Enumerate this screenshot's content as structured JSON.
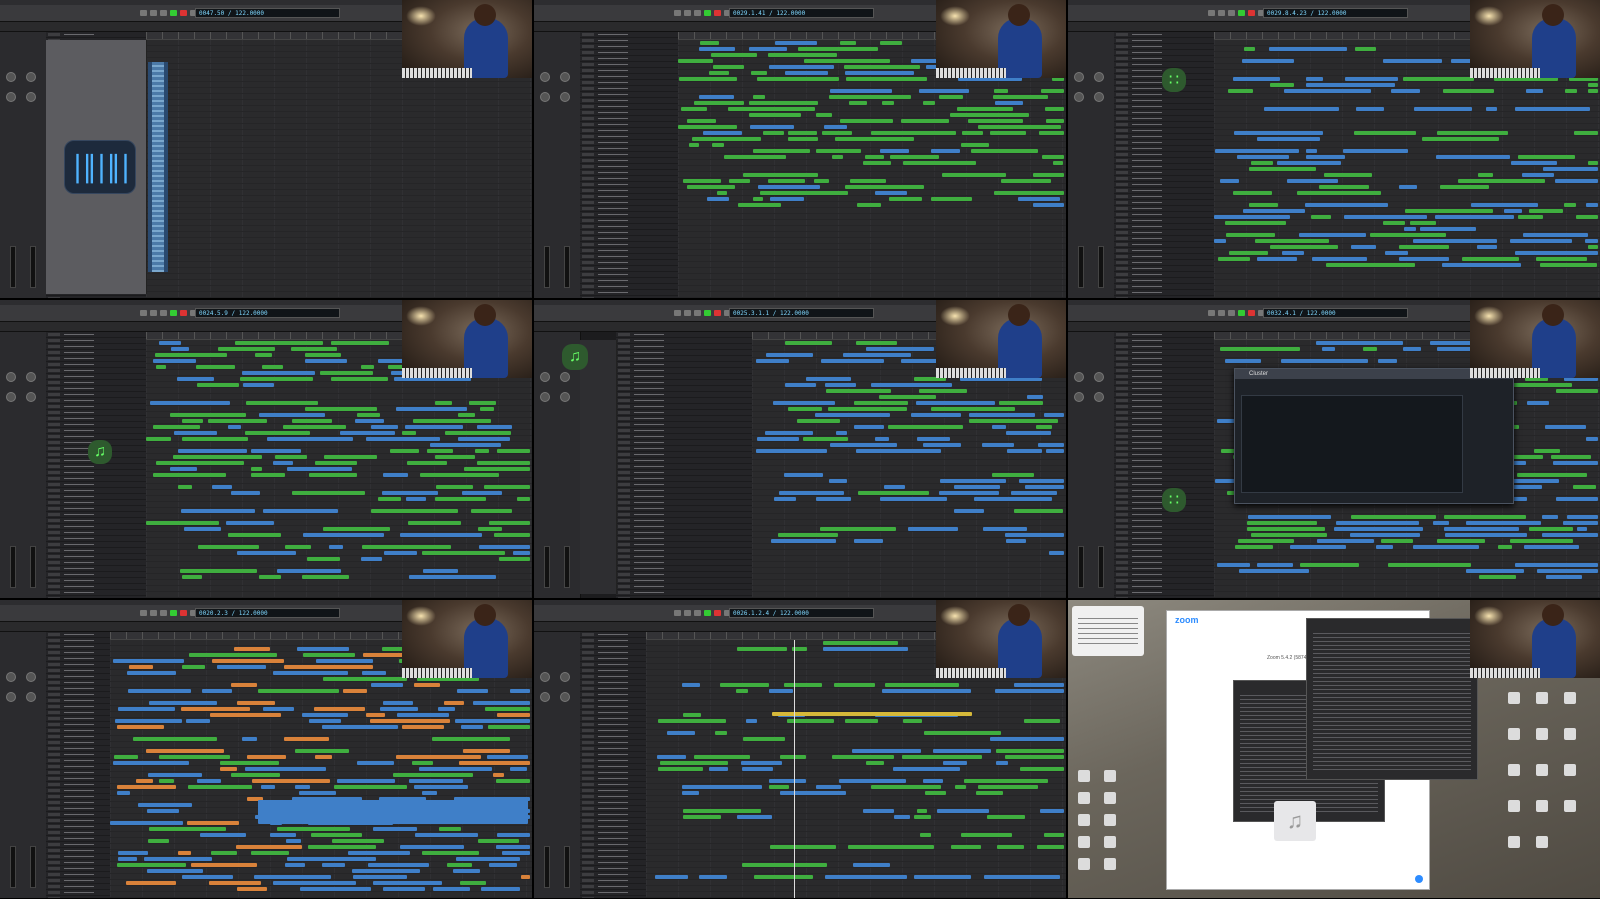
{
  "page": {
    "title": ""
  },
  "panels": [
    {
      "id": "panel-1",
      "lcd": "0047.50 / 122.0000",
      "view": "audio-file-plugin",
      "icon": "waveform-icon"
    },
    {
      "id": "panel-2",
      "lcd": "0029.1.41 / 122.0000",
      "view": "arrange-green-regions"
    },
    {
      "id": "panel-3",
      "lcd": "0029.8.4.23 / 122.0000",
      "view": "arrange-mixed-regions",
      "icon": "waveform-icon"
    },
    {
      "id": "panel-4",
      "lcd": "0024.5.9 / 122.0000",
      "view": "arrange-drummer",
      "icon": "music-note-icon"
    },
    {
      "id": "panel-5",
      "lcd": "0025.3.1.1 / 122.0000",
      "view": "library-and-arrange",
      "icon": "music-note-icon"
    },
    {
      "id": "panel-6",
      "lcd": "0032.4.1 / 122.0000",
      "view": "plugin-eq-window",
      "plugin_title": "Cluster",
      "icon": "waveform-icon"
    },
    {
      "id": "panel-7",
      "lcd": "0020.2.3 / 122.0000",
      "view": "arrange-blue-audio"
    },
    {
      "id": "panel-8",
      "lcd": "0026.1.2.4 / 122.0000",
      "view": "arrange-yellow-selection"
    },
    {
      "id": "panel-9",
      "view": "desktop-zoom",
      "zoom_logo": "zoom",
      "zoom_caption": "Zoom 5.4.2 (58740.1105)",
      "icon": "music-note-icon"
    }
  ],
  "colors": {
    "region_green": "#3fae3f",
    "region_blue": "#3f7fc8",
    "region_yellow": "#d6b93a",
    "zoom_blue": "#2d8cff"
  }
}
